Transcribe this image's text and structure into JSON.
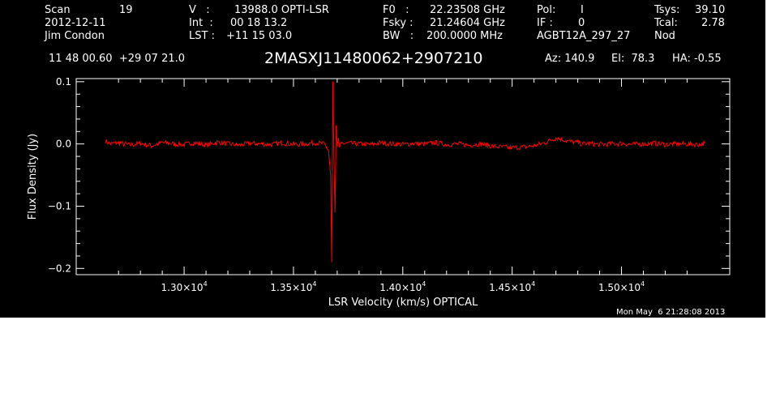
{
  "header": {
    "scan_label": "Scan",
    "scan_value": "19",
    "date": "2012-12-11",
    "observer": "Jim Condon",
    "v_label": "V   :",
    "v_value": "13988.0 OPTI-LSR",
    "int_label": "Int  :",
    "int_value": "00 18 13.2",
    "lst_label": "LST :",
    "lst_value": "+11 15 03.0",
    "f0_label": "F0   :",
    "f0_value": "22.23508 GHz",
    "fsky_label": "Fsky :",
    "fsky_value": "21.24604 GHz",
    "bw_label": "BW   :",
    "bw_value": "200.0000 MHz",
    "pol_label": "Pol:",
    "pol_value": "I",
    "if_label": "IF :",
    "if_value": "0",
    "project": "AGBT12A_297_27",
    "tsys_label": "Tsys:",
    "tsys_value": "39.10",
    "tcal_label": "Tcal:",
    "tcal_value": "2.78",
    "mode": "Nod",
    "coords": "11 48 00.60  +29 07 21.0",
    "source": "2MASXJ11480062+2907210",
    "az": "Az: 140.9",
    "el": "El:  78.3",
    "ha": "HA: -0.55"
  },
  "footer": {
    "timestamp": "Mon May  6 21:28:08 2013"
  },
  "colors": {
    "background": "#000000",
    "axes": "#ffffff",
    "trace": "#ff0000"
  },
  "chart_data": {
    "type": "line",
    "xlabel": "LSR Velocity (km/s) OPTICAL",
    "ylabel": "Flux Density (Jy)",
    "xlim": [
      12620,
      13420
    ],
    "ylim": [
      -0.21,
      0.105
    ],
    "x_ticks": [
      {
        "value": 13000,
        "label": "1.30×10",
        "exp": "4"
      },
      {
        "value": 13500,
        "label": "1.35×10",
        "exp": "4"
      },
      {
        "value": 14000,
        "label": "1.40×10",
        "exp": "4"
      },
      {
        "value": 14500,
        "label": "1.45×10",
        "exp": "4"
      },
      {
        "value": 15000,
        "label": "1.50×10",
        "exp": "4"
      }
    ],
    "y_ticks": [
      {
        "value": 0.1,
        "label": "0.1"
      },
      {
        "value": 0.0,
        "label": "0.0"
      },
      {
        "value": -0.1,
        "label": "−0.1"
      },
      {
        "value": -0.2,
        "label": "−0.2"
      }
    ],
    "grid": false,
    "series": [
      {
        "x": [
          12640,
          12660,
          12700,
          12750,
          12800,
          12850,
          12900,
          12950,
          13000,
          13050,
          13100,
          13150,
          13200,
          13250,
          13300,
          13350,
          13400,
          13450,
          13500,
          13550,
          13600,
          13640,
          13660,
          13670,
          13675,
          13680,
          13685,
          13690,
          13695,
          13700,
          13705,
          13710,
          13715,
          13720,
          13730,
          13750,
          13800,
          13850,
          13900,
          13950,
          14000,
          14050,
          14100,
          14150,
          14200,
          14250,
          14300,
          14350,
          14400,
          14450,
          14500,
          14550,
          14600,
          14650,
          14700,
          14740,
          14760,
          14780,
          14800,
          14820,
          14850,
          14900,
          14950,
          15000,
          15050,
          15100,
          15150,
          15200,
          15250,
          15300,
          15350,
          15380
        ],
        "y": [
          0.005,
          0.0,
          0.002,
          -0.002,
          0.001,
          -0.003,
          0.002,
          0.0,
          -0.001,
          0.002,
          -0.002,
          0.003,
          0.0,
          -0.002,
          0.001,
          0.0,
          -0.001,
          0.002,
          -0.001,
          0.0,
          0.002,
          0.0,
          -0.01,
          -0.05,
          -0.19,
          0.1,
          -0.02,
          -0.11,
          0.03,
          -0.005,
          0.01,
          -0.004,
          0.0,
          0.003,
          0.0,
          0.001,
          0.0,
          -0.001,
          0.002,
          0.0,
          -0.001,
          0.001,
          0.0,
          0.002,
          -0.001,
          0.0,
          -0.002,
          0.0,
          -0.003,
          -0.005,
          -0.006,
          -0.005,
          -0.003,
          0.002,
          0.01,
          0.006,
          0.004,
          0.003,
          0.002,
          0.0,
          0.001,
          -0.001,
          0.0,
          0.001,
          -0.001,
          0.0,
          0.001,
          -0.001,
          0.0,
          0.0,
          -0.001,
          0.001
        ]
      }
    ]
  }
}
